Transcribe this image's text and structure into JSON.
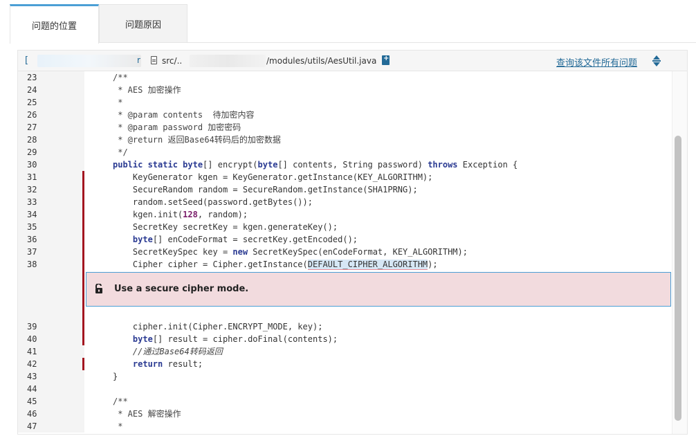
{
  "tabs": [
    {
      "label": "问题的位置",
      "active": true
    },
    {
      "label": "问题原因",
      "active": false
    }
  ],
  "header": {
    "start_fragment": "[",
    "mid_fragment": "r",
    "path_prefix": "src/..",
    "path_suffix": "/modules/utils/AesUtil.java",
    "link_label": "查询该文件所有问题"
  },
  "issue": {
    "message": "Use a secure cipher mode.",
    "icon": "unlock-icon",
    "highlight_token": "DEFAULT_CIPHER_ALGORITHM"
  },
  "colors": {
    "accent": "#4b9fd5",
    "issue_marker": "#a31520",
    "issue_background": "#f2dbde",
    "link": "#236a97",
    "keyword": "#2a3a92"
  },
  "code_lines": [
    {
      "n": "23",
      "marked": false,
      "tokens": [
        [
          "cm",
          "/**"
        ]
      ]
    },
    {
      "n": "24",
      "marked": false,
      "tokens": [
        [
          "cm",
          " * AES 加密操作"
        ]
      ]
    },
    {
      "n": "25",
      "marked": false,
      "tokens": [
        [
          "cm",
          " *"
        ]
      ]
    },
    {
      "n": "26",
      "marked": false,
      "tokens": [
        [
          "cm",
          " * @param contents  待加密内容"
        ]
      ]
    },
    {
      "n": "27",
      "marked": false,
      "tokens": [
        [
          "cm",
          " * @param password 加密密码"
        ]
      ]
    },
    {
      "n": "28",
      "marked": false,
      "tokens": [
        [
          "cm",
          " * @return 返回Base64转码后的加密数据"
        ]
      ]
    },
    {
      "n": "29",
      "marked": false,
      "tokens": [
        [
          "cm",
          " */"
        ]
      ]
    },
    {
      "n": "30",
      "marked": false,
      "tokens": [
        [
          "kw",
          "public static byte"
        ],
        [
          "t",
          "[] encrypt("
        ],
        [
          "kw",
          "byte"
        ],
        [
          "t",
          "[] contents, String password) "
        ],
        [
          "kw",
          "throws"
        ],
        [
          "t",
          " Exception {"
        ]
      ]
    },
    {
      "n": "31",
      "marked": true,
      "tokens": [
        [
          "t",
          "    KeyGenerator kgen = KeyGenerator.getInstance(KEY_ALGORITHM);"
        ]
      ]
    },
    {
      "n": "32",
      "marked": true,
      "tokens": [
        [
          "t",
          "    SecureRandom random = SecureRandom.getInstance(SHA1PRNG);"
        ]
      ]
    },
    {
      "n": "33",
      "marked": true,
      "tokens": [
        [
          "t",
          "    random.setSeed(password.getBytes());"
        ]
      ]
    },
    {
      "n": "34",
      "marked": true,
      "tokens": [
        [
          "t",
          "    kgen.init("
        ],
        [
          "num",
          "128"
        ],
        [
          "t",
          ", random);"
        ]
      ]
    },
    {
      "n": "35",
      "marked": true,
      "tokens": [
        [
          "t",
          "    SecretKey secretKey = kgen.generateKey();"
        ]
      ]
    },
    {
      "n": "36",
      "marked": true,
      "tokens": [
        [
          "t",
          "    "
        ],
        [
          "kw",
          "byte"
        ],
        [
          "t",
          "[] enCodeFormat = secretKey.getEncoded();"
        ]
      ]
    },
    {
      "n": "37",
      "marked": true,
      "tokens": [
        [
          "t",
          "    SecretKeySpec key = "
        ],
        [
          "kw",
          "new"
        ],
        [
          "t",
          " SecretKeySpec(enCodeFormat, KEY_ALGORITHM);"
        ]
      ]
    },
    {
      "n": "38",
      "marked": true,
      "tokens": [
        [
          "t",
          "    Cipher cipher = Cipher.getInstance("
        ],
        [
          "hl",
          "DEFAULT_CIPHER_ALGORITHM"
        ],
        [
          "t",
          ");"
        ]
      ]
    },
    {
      "issue": true
    },
    {
      "n": "39",
      "marked": true,
      "tokens": [
        [
          "t",
          "    cipher.init(Cipher.ENCRYPT_MODE, key);"
        ]
      ]
    },
    {
      "n": "40",
      "marked": true,
      "tokens": [
        [
          "t",
          "    "
        ],
        [
          "kw",
          "byte"
        ],
        [
          "t",
          "[] result = cipher.doFinal(contents);"
        ]
      ]
    },
    {
      "n": "41",
      "marked": false,
      "tokens": [
        [
          "cmi",
          "    //通过Base64转码返回"
        ]
      ]
    },
    {
      "n": "42",
      "marked": true,
      "tokens": [
        [
          "t",
          "    "
        ],
        [
          "kw",
          "return"
        ],
        [
          "t",
          " result;"
        ]
      ]
    },
    {
      "n": "43",
      "marked": false,
      "tokens": [
        [
          "t",
          "}"
        ]
      ]
    },
    {
      "n": "44",
      "marked": false,
      "tokens": []
    },
    {
      "n": "45",
      "marked": false,
      "tokens": [
        [
          "cm",
          "/**"
        ]
      ]
    },
    {
      "n": "46",
      "marked": false,
      "tokens": [
        [
          "cm",
          " * AES 解密操作"
        ]
      ]
    },
    {
      "n": "47",
      "marked": false,
      "tokens": [
        [
          "cm",
          " *"
        ]
      ]
    }
  ]
}
